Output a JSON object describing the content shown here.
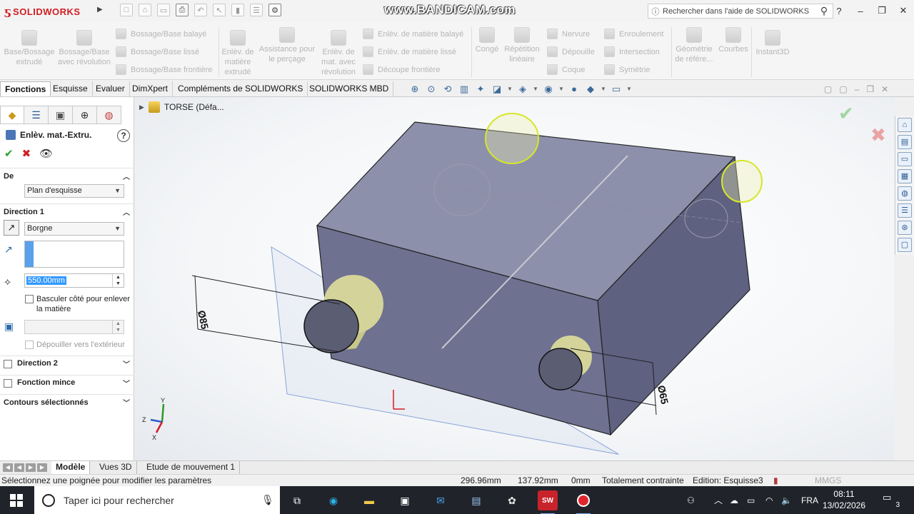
{
  "app": {
    "brand": "SOLIDWORKS",
    "watermark": "www.BANDICAM.com",
    "search_placeholder": "Rechercher dans l'aide de SOLIDWORKS",
    "window_controls": [
      "?",
      "–",
      "❐",
      "✕"
    ]
  },
  "ribbon": {
    "big_items": [
      {
        "label": "Base/Bossage extrudé"
      },
      {
        "label": "Bossage/Base avec révolution"
      },
      {
        "label": "Enlèv. de matière extrudé"
      },
      {
        "label": "Assistance pour le perçage"
      },
      {
        "label": "Enlèv. de mat. avec révolution"
      },
      {
        "label": "Congé"
      },
      {
        "label": "Répétition linéaire"
      },
      {
        "label": "Géométrie de référe..."
      },
      {
        "label": "Courbes"
      },
      {
        "label": "Instant3D"
      }
    ],
    "small_items": [
      "Bossage/Base balayé",
      "Bossage/Base lissé",
      "Bossage/Base frontière",
      "Enlèv. de matière balayé",
      "Enlèv. de matière lissé",
      "Découpe frontière",
      "Nervure",
      "Dépouille",
      "Coque",
      "Enroulement",
      "Intersection",
      "Symétrie"
    ]
  },
  "tabs": [
    "Fonctions",
    "Esquisse",
    "Evaluer",
    "DimXpert",
    "Compléments de SOLIDWORKS",
    "SOLIDWORKS MBD"
  ],
  "tree": {
    "label": "TORSE  (Défa..."
  },
  "property_manager": {
    "title": "Enlèv. mat.-Extru.",
    "help": "?",
    "de_label": "De",
    "de_value": "Plan d'esquisse",
    "direction1_label": "Direction 1",
    "end_condition": "Borgne",
    "depth": "550.00mm",
    "flip_side_label": "Basculer côté pour enlever la matière",
    "draft_outward_label": "Dépouiller vers l'extérieur",
    "direction2_label": "Direction 2",
    "thin_feature_label": "Fonction mince",
    "selected_contours_label": "Contours sélectionnés"
  },
  "viewport": {
    "dim_large": "Ø85",
    "dim_small": "Ø65",
    "triad": {
      "x": "X",
      "y": "Y",
      "z": "Z"
    },
    "colors": {
      "body": "#7a7d98",
      "boss": "#d4d49a",
      "plane": "#9fb3dd"
    }
  },
  "bottom_tabs": [
    "Modèle",
    "Vues 3D",
    "Etude de mouvement 1"
  ],
  "status": {
    "message": "Sélectionnez une poignée pour modifier les paramètres",
    "x": "296.96mm",
    "y": "137.92mm",
    "z": "0mm",
    "state": "Totalement contrainte",
    "edit": "Edition: Esquisse3",
    "units": "MMGS"
  },
  "taskbar": {
    "search_placeholder": "Taper ici pour rechercher",
    "lang": "FRA",
    "time": "08:11",
    "date": "13/02/2026",
    "notifications": "3"
  }
}
